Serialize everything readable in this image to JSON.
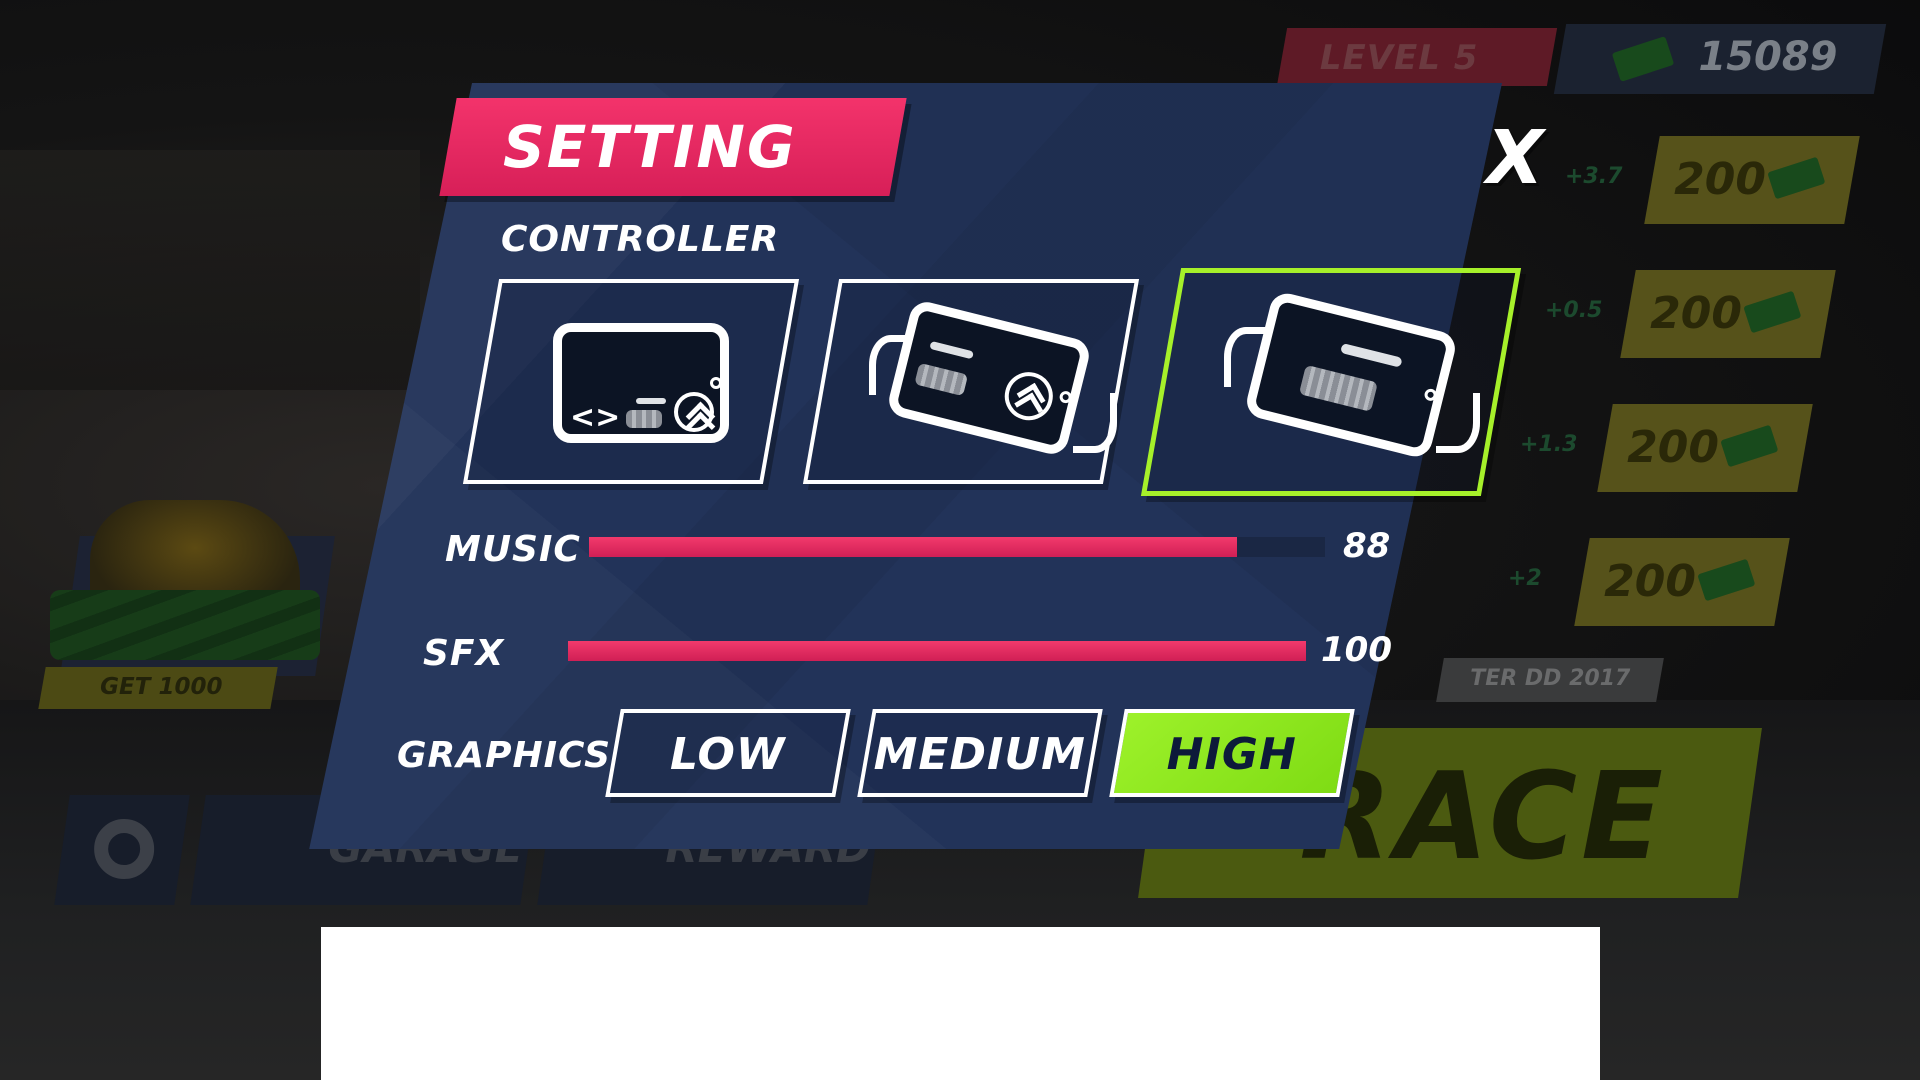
{
  "background": {
    "level_label": "LEVEL 5",
    "cash_amount": "15089",
    "upgrades": [
      {
        "price": "200",
        "delta": "+3.7"
      },
      {
        "price": "200",
        "delta": "+0.5"
      },
      {
        "price": "200",
        "delta": "+1.3"
      },
      {
        "price": "200",
        "delta": "+2"
      }
    ],
    "event_label": "TER DD 2017",
    "race_label": "RACE",
    "offer_label": "GET 1000",
    "nav": {
      "garage": "GARAGE",
      "reward": "REWARD"
    }
  },
  "settings": {
    "title": "SETTING",
    "close_label": "X",
    "controller_label": "CONTROLLER",
    "controllers": [
      {
        "id": "touch-buttons",
        "icon": "touch-controls-icon",
        "selected": false
      },
      {
        "id": "tilt-split",
        "icon": "tilt-split-controls-icon",
        "selected": false
      },
      {
        "id": "tilt-throttle",
        "icon": "tilt-throttle-controls-icon",
        "selected": true
      }
    ],
    "music_label": "MUSIC",
    "music_value": "88",
    "sfx_label": "SFX",
    "sfx_value": "100",
    "graphics_label": "GRAPHICS",
    "graphics_options": [
      "LOW",
      "MEDIUM",
      "HIGH"
    ],
    "graphics_selected": "HIGH"
  },
  "colors": {
    "accent_pink": "#e8285f",
    "accent_green": "#94ea22",
    "panel_navy": "#223359"
  }
}
